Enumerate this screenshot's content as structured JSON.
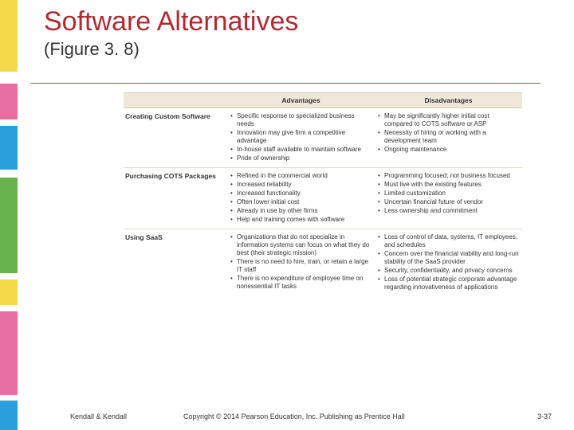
{
  "header": {
    "title": "Software Alternatives",
    "subtitle": "(Figure 3. 8)"
  },
  "table": {
    "columns": {
      "c1": "",
      "c2": "Advantages",
      "c3": "Disadvantages"
    },
    "rows": [
      {
        "label": "Creating Custom Software",
        "adv": [
          "Specific response to specialized business needs",
          "Innovation may give firm a competitive advantage",
          "In-house staff available to maintain software",
          "Pride of ownership"
        ],
        "dis": [
          "May be significantly higher initial cost compared to COTS software or ASP",
          "Necessity of hiring or working with a development team",
          "Ongoing maintenance"
        ]
      },
      {
        "label": "Purchasing COTS Packages",
        "adv": [
          "Refined in the commercial world",
          "Increased reliability",
          "Increased functionality",
          "Often lower initial cost",
          "Already in use by other firms",
          "Help and training comes with software"
        ],
        "dis": [
          "Programming focused; not business focused",
          "Must live with the existing features",
          "Limited customization",
          "Uncertain financial future of vendor",
          "Less ownership and commitment"
        ]
      },
      {
        "label": "Using SaaS",
        "adv": [
          "Organizations that do not specialize in information systems can focus on what they do best (their strategic mission)",
          "There is no need to hire, train, or retain a large IT staff",
          "There is no expenditure of employee time on nonessential IT tasks"
        ],
        "dis": [
          "Loss of control of data, systems, IT employees, and schedules",
          "Concern over the financial viability and long-run stability of the SaaS provider",
          "Security, confidentiality, and privacy concerns",
          "Loss of potential strategic corporate advantage regarding innovativeness of applications"
        ]
      }
    ]
  },
  "footer": {
    "authors": "Kendall & Kendall",
    "copyright": "Copyright © 2014 Pearson Education, Inc. Publishing as Prentice Hall",
    "pageno": "3-37"
  }
}
